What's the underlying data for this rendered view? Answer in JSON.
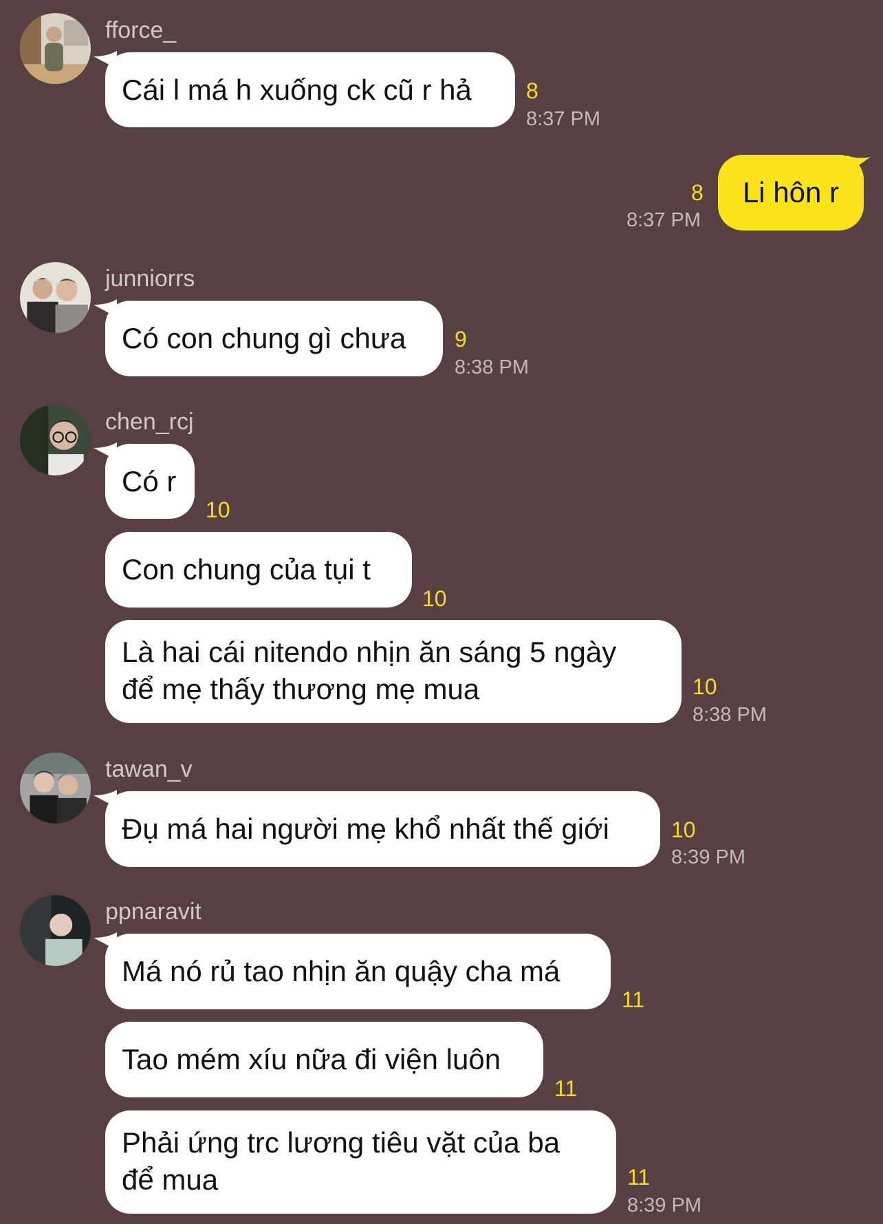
{
  "colors": {
    "background": "#564042",
    "bubble_other": "#ffffff",
    "bubble_mine": "#fbe41b",
    "unread_count": "#f5dc2a",
    "timestamp": "#c6b8b9",
    "sender_name": "#d4c7c8"
  },
  "messages": {
    "m1": {
      "sender": "fforce_",
      "text": "Cái l má h xuống ck cũ r hả",
      "unread": "8",
      "time": "8:37 PM"
    },
    "m2": {
      "text": "Li hôn r",
      "unread": "8",
      "time": "8:37 PM"
    },
    "m3": {
      "sender": "junniorrs",
      "text": "Có con chung gì chưa",
      "unread": "9",
      "time": "8:38 PM"
    },
    "m4": {
      "sender": "chen_rcj",
      "b1": {
        "text": "Có r",
        "unread": "10"
      },
      "b2": {
        "text": "Con chung của tụi t",
        "unread": "10"
      },
      "b3": {
        "line1": "Là hai cái nitendo nhịn ăn sáng 5 ngày",
        "line2": "để mẹ thấy thương mẹ mua",
        "unread": "10",
        "time": "8:38 PM"
      }
    },
    "m5": {
      "sender": "tawan_v",
      "text": "Đụ má hai người mẹ khổ nhất thế giới",
      "unread": "10",
      "time": "8:39 PM"
    },
    "m6": {
      "sender": "ppnaravit",
      "b1": {
        "text": "Má nó rủ tao nhịn ăn quậy cha má",
        "unread": "11"
      },
      "b2": {
        "text": "Tao mém xíu nữa đi viện luôn",
        "unread": "11"
      },
      "b3": {
        "line1": "Phải ứng trc lương tiêu vặt của ba",
        "line2": "để mua",
        "unread": "11",
        "time": "8:39 PM"
      }
    }
  },
  "icons": {
    "avatar1": "profile-photo-icon",
    "avatar2": "profile-photo-icon",
    "avatar3": "profile-photo-icon",
    "avatar4": "profile-photo-icon",
    "avatar5": "profile-photo-icon"
  }
}
